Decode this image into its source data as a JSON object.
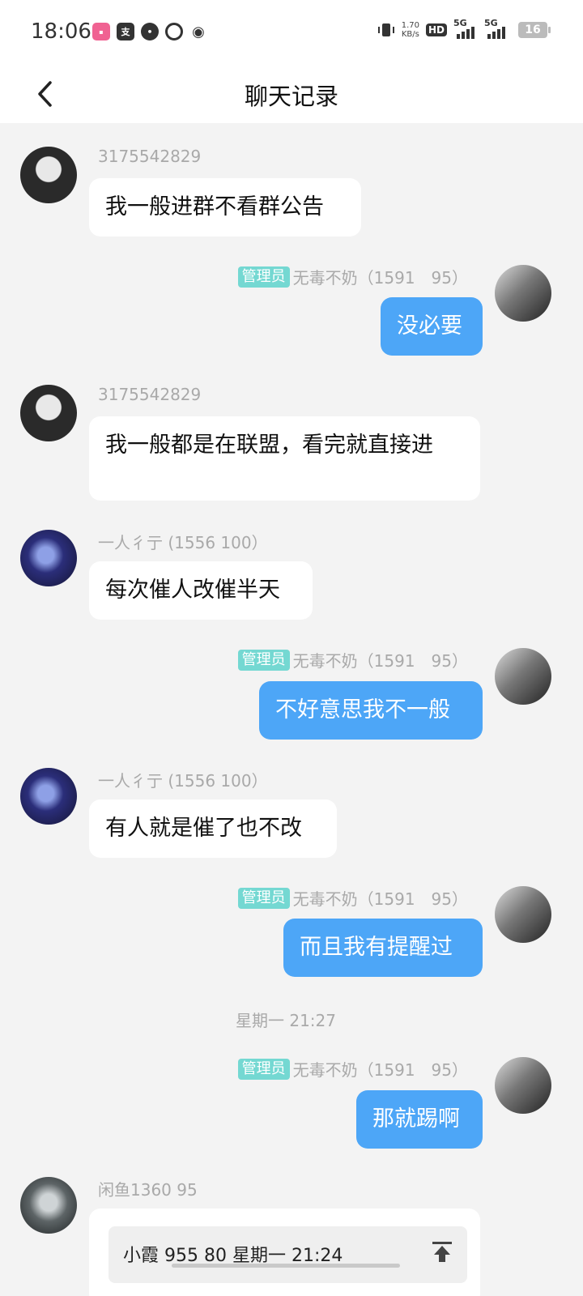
{
  "status_bar": {
    "time": "18:06",
    "net_speed_value": "1.70",
    "net_speed_unit": "KB/s",
    "hd_label": "HD",
    "sim1_label": "5G",
    "sim2_label": "5G",
    "battery": "16"
  },
  "header": {
    "title": "聊天记录"
  },
  "messages": [
    {
      "side": "left",
      "sender": "3175542829",
      "text": "我一般进群不看群公告"
    },
    {
      "side": "right",
      "badge": "管理员",
      "sender": "无毒不奶（1591　95）",
      "text": "没必要"
    },
    {
      "side": "left",
      "sender": "3175542829",
      "text": "我一般都是在联盟，看完就直接进"
    },
    {
      "side": "left",
      "sender": "一人彳亍 (1556  100）",
      "text": "每次催人改催半天"
    },
    {
      "side": "right",
      "badge": "管理员",
      "sender": "无毒不奶（1591　95）",
      "text": "不好意思我不一般"
    },
    {
      "side": "left",
      "sender": "一人彳亍 (1556  100）",
      "text": "有人就是催了也不改"
    },
    {
      "side": "right",
      "badge": "管理员",
      "sender": "无毒不奶（1591　95）",
      "text": "而且我有提醒过"
    },
    {
      "side": "right",
      "badge": "管理员",
      "sender": "无毒不奶（1591　95）",
      "text": "那就踢啊"
    },
    {
      "side": "left",
      "sender": "闲鱼1360  95",
      "quote": "小霞  955  80 星期一 21:24"
    }
  ],
  "timestamp": "星期一 21:27",
  "colors": {
    "bubble_right": "#4da6f7",
    "admin_badge": "#74d8d2",
    "background": "#f3f3f3"
  }
}
